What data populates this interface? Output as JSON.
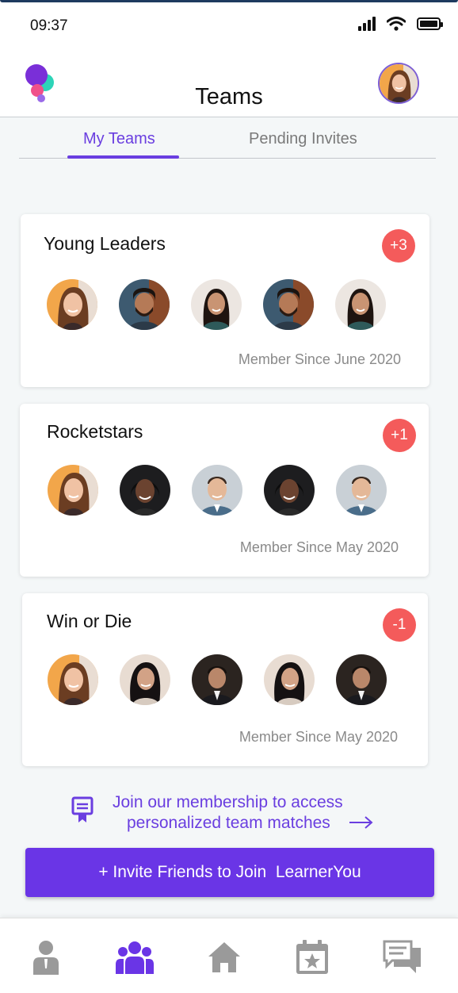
{
  "status_bar": {
    "time": "09:37"
  },
  "header": {
    "title": "Teams"
  },
  "tabs": [
    {
      "label": "My Teams",
      "active": true
    },
    {
      "label": "Pending Invites",
      "active": false
    }
  ],
  "teams": [
    {
      "name": "Young Leaders",
      "badge": "+3",
      "member_since": "Member Since June 2020"
    },
    {
      "name": "Rocketstars",
      "badge": "+1",
      "member_since": "Member Since May 2020"
    },
    {
      "name": "Win or Die",
      "badge": "-1",
      "member_since": "Member Since May 2020"
    }
  ],
  "promo": {
    "line1": "Join our membership to access",
    "line2": "personalized team matches"
  },
  "invite_button": {
    "label": "+ Invite Friends to Join  LearnerYou"
  },
  "bottom_nav": [
    {
      "icon": "person-icon",
      "active": false
    },
    {
      "icon": "team-icon",
      "active": true
    },
    {
      "icon": "home-icon",
      "active": false
    },
    {
      "icon": "calendar-star-icon",
      "active": false
    },
    {
      "icon": "chat-icon",
      "active": false
    }
  ],
  "colors": {
    "accent": "#6a3ee0",
    "badge": "#f45b5b",
    "button": "#6a35e6",
    "nav_inactive": "#9a9a9a"
  }
}
